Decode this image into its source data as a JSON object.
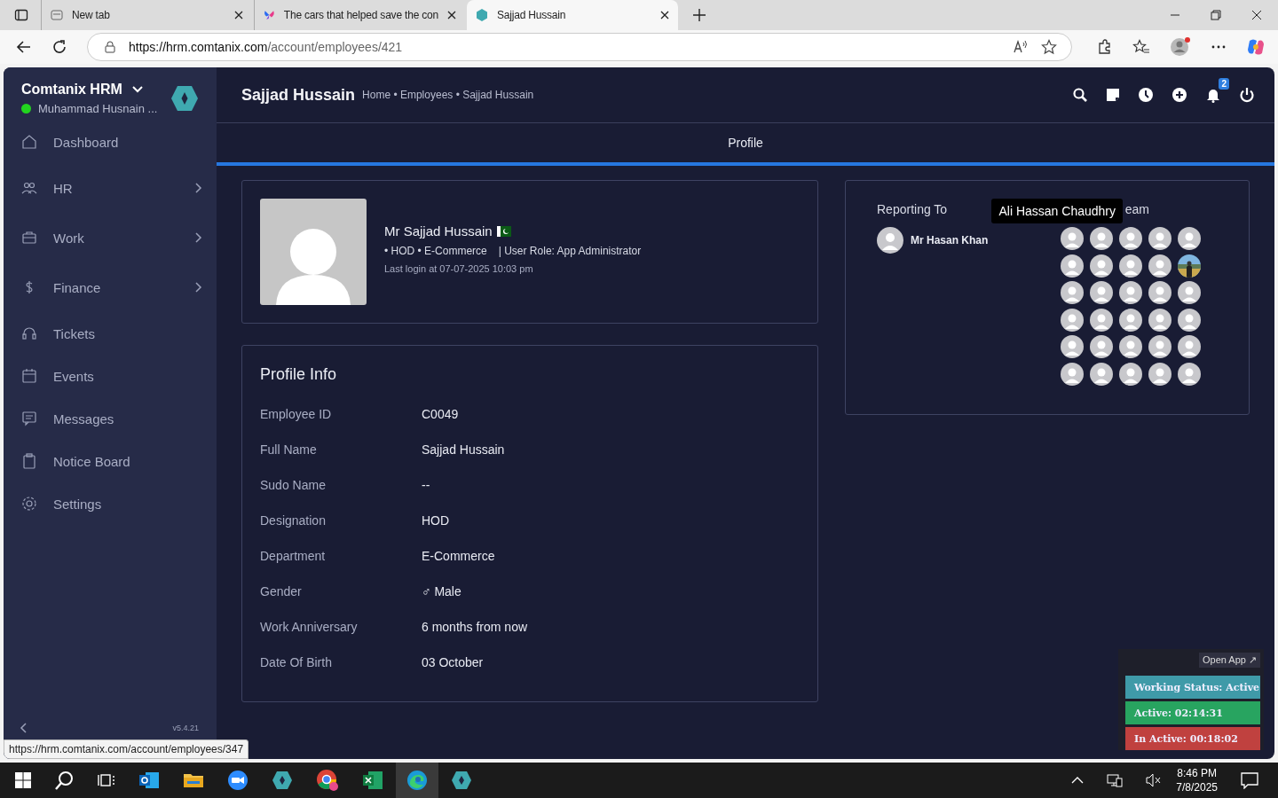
{
  "browser": {
    "tabs": [
      {
        "title": "New tab",
        "selected": false
      },
      {
        "title": "The cars that helped save the con",
        "selected": false
      },
      {
        "title": "Sajjad Hussain",
        "selected": true
      }
    ],
    "url_host": "https://hrm.comtanix.com",
    "url_path": "/account/employees/421",
    "status_url": "https://hrm.comtanix.com/account/employees/347"
  },
  "sidebar": {
    "org": "Comtanix HRM",
    "user": "Muhammad Husnain ...",
    "online": true,
    "version": "v5.4.21",
    "items": [
      {
        "label": "Dashboard",
        "submenu": false
      },
      {
        "label": "HR",
        "submenu": true
      },
      {
        "label": "Work",
        "submenu": true
      },
      {
        "label": "Finance",
        "submenu": true
      },
      {
        "label": "Tickets",
        "submenu": false
      },
      {
        "label": "Events",
        "submenu": false
      },
      {
        "label": "Messages",
        "submenu": false
      },
      {
        "label": "Notice Board",
        "submenu": false
      },
      {
        "label": "Settings",
        "submenu": false
      }
    ]
  },
  "header": {
    "title": "Sajjad Hussain",
    "breadcrumb": "Home • Employees • Sajjad Hussain",
    "notification_count": "2"
  },
  "tabs": [
    {
      "label": "Profile",
      "selected": true
    }
  ],
  "profile": {
    "name": "Mr Sajjad Hussain",
    "meta": "• HOD • E-Commerce",
    "role": "| User Role: App Administrator",
    "last_login": "Last login at 07-07-2025 10:03 pm"
  },
  "profile_info": {
    "title": "Profile Info",
    "rows": [
      {
        "label": "Employee ID",
        "value": "C0049"
      },
      {
        "label": "Full Name",
        "value": "Sajjad Hussain"
      },
      {
        "label": "Sudo Name",
        "value": "--"
      },
      {
        "label": "Designation",
        "value": "HOD"
      },
      {
        "label": "Department",
        "value": "E-Commerce"
      },
      {
        "label": "Gender",
        "value": "♂ Male"
      },
      {
        "label": "Work Anniversary",
        "value": "6 months from now"
      },
      {
        "label": "Date Of Birth",
        "value": "03 October"
      }
    ]
  },
  "reporting": {
    "heading": "Reporting To",
    "manager": "Mr Hasan Khan",
    "team_heading_visible": "eam",
    "tooltip": "Ali Hassan Chaudhry",
    "team": [
      {
        "kind": "default"
      },
      {
        "kind": "default"
      },
      {
        "kind": "default"
      },
      {
        "kind": "default"
      },
      {
        "kind": "default"
      },
      {
        "kind": "default"
      },
      {
        "kind": "default"
      },
      {
        "kind": "default"
      },
      {
        "kind": "default"
      },
      {
        "kind": "picture"
      },
      {
        "kind": "default"
      },
      {
        "kind": "default"
      },
      {
        "kind": "default"
      },
      {
        "kind": "default"
      },
      {
        "kind": "default"
      },
      {
        "kind": "default"
      },
      {
        "kind": "default"
      },
      {
        "kind": "default"
      },
      {
        "kind": "default"
      },
      {
        "kind": "default"
      },
      {
        "kind": "default"
      },
      {
        "kind": "default"
      },
      {
        "kind": "default"
      },
      {
        "kind": "default"
      },
      {
        "kind": "default"
      },
      {
        "kind": "default"
      },
      {
        "kind": "default"
      },
      {
        "kind": "default"
      },
      {
        "kind": "default"
      },
      {
        "kind": "default"
      }
    ]
  },
  "status_widget": {
    "open_app": "Open App ↗",
    "rows": [
      {
        "text": "Working Status: Active",
        "color": "#3f9aa8"
      },
      {
        "text": "Active: 02:14:31",
        "color": "#28a460"
      },
      {
        "text": "In Active: 00:18:02",
        "color": "#c0413f"
      }
    ]
  },
  "taskbar": {
    "time": "8:46 PM",
    "date": "7/8/2025"
  }
}
